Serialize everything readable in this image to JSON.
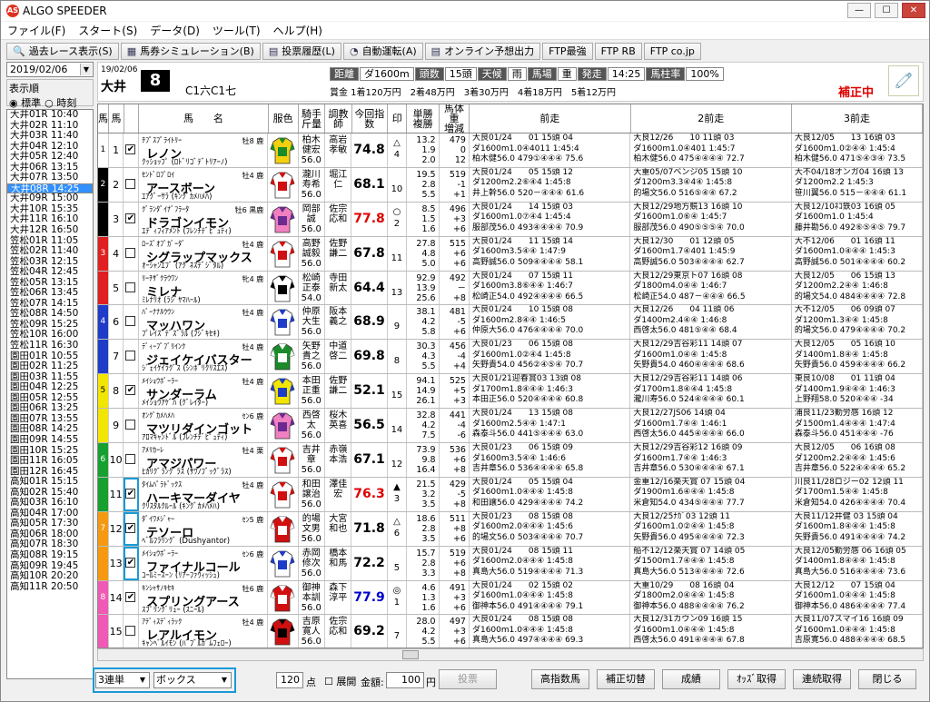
{
  "window": {
    "title": "ALGO SPEEDER",
    "app_icon": "AS"
  },
  "menu": [
    "ファイル(F)",
    "スタート(S)",
    "データ(D)",
    "ツール(T)",
    "ヘルプ(H)"
  ],
  "toolbar": [
    {
      "label": "過去レース表示(S)",
      "icon": "🔍"
    },
    {
      "label": "馬券シミュレーション(B)",
      "icon": "▦"
    },
    {
      "label": "投票履歴(L)",
      "icon": "▤"
    },
    {
      "label": "自動運転(A)",
      "icon": "◔"
    },
    {
      "label": "オンライン予想出力",
      "icon": "▤"
    },
    {
      "label": "FTP最強",
      "icon": ""
    },
    {
      "label": "FTP RB",
      "icon": ""
    },
    {
      "label": "FTP co.jp",
      "icon": ""
    }
  ],
  "left": {
    "date": "2019/02/06",
    "order_label": "表示順",
    "order_options": [
      "標準",
      "時刻"
    ],
    "races": [
      "大井01R 10:40",
      "大井02R 11:10",
      "大井03R 11:40",
      "大井04R 12:10",
      "大井05R 12:40",
      "大井06R 13:15",
      "大井07R 13:50",
      "大井08R 14:25",
      "大井09R 15:00",
      "大井10R 15:35",
      "大井11R 16:10",
      "大井12R 16:50",
      "笠松01R 11:05",
      "笠松02R 11:40",
      "笠松03R 12:15",
      "笠松04R 12:45",
      "笠松05R 13:15",
      "笠松06R 13:45",
      "笠松07R 14:15",
      "笠松08R 14:50",
      "笠松09R 15:25",
      "笠松10R 16:00",
      "笠松11R 16:30",
      "園田01R 10:55",
      "園田02R 11:25",
      "園田03R 11:55",
      "園田04R 12:25",
      "園田05R 12:55",
      "園田06R 13:25",
      "園田07R 13:55",
      "園田08R 14:25",
      "園田09R 14:55",
      "園田10R 15:25",
      "園田11R 16:05",
      "園田12R 16:45",
      "高知01R 15:15",
      "高知02R 15:40",
      "高知03R 16:10",
      "高知04R 17:00",
      "高知05R 17:30",
      "高知06R 18:00",
      "高知07R 18:30",
      "高知08R 19:15",
      "高知09R 19:45",
      "高知10R 20:20",
      "高知11R 20:50"
    ],
    "selected_index": 7
  },
  "header": {
    "date": "19/02/06",
    "venue": "大井",
    "race_no": "8",
    "class": "C1六C1七",
    "distance_label": "距離",
    "distance": "ダ1600m",
    "count_label": "頭数",
    "count": "15頭",
    "weather_label": "天候",
    "weather": "雨",
    "track_label": "馬場",
    "track": "重",
    "post_label": "発走",
    "post": "14:25",
    "ratio_label": "馬柱率",
    "ratio": "100%",
    "prizes": [
      "賞金 1着120万円",
      "2着48万円",
      "3着30万円",
      "4着18万円",
      "5着12万円"
    ],
    "correction": "補正中"
  },
  "columns": [
    "馬",
    "馬",
    "馬　　名",
    "服色",
    "騎手\n斤量",
    "調教\n師",
    "今回指数",
    "印",
    "単勝\n複勝",
    "馬体重\n増減",
    "前走",
    "2前走",
    "3前走"
  ],
  "waku_colors": [
    "#ffffff",
    "#000000",
    "#e02020",
    "#1e3cc8",
    "#f2e600",
    "#16a030",
    "#f59a10",
    "#f05ab4"
  ],
  "horses": [
    {
      "waku": 1,
      "no": "1",
      "check": true,
      "hl": false,
      "sire": "ﾁﾌﾟｽﾌﾟﾗｲﾄﾘｰ",
      "sex": "牡8 鹿",
      "name": "レノン",
      "dam": "ｸｯｼｮｯﾌﾟ (ﾛﾄﾞﾘｺﾞﾃﾞﾄﾘｱｰﾉ)",
      "silk": [
        "#f5d010",
        "#1a8a2a"
      ],
      "jockey": "柏木\n健宏\n56.0",
      "trainer": "高岩\n孝敏",
      "index": "74.8",
      "idxc": "",
      "mark": "△\n4",
      "odds": "13.2\n1.9\n2.0",
      "weight": "479\n0\n12",
      "r1": [
        "大良01/24　　01 15頭 04",
        "ダ1600m1.0④4011 1:45:4",
        "柏木健56.0 479①④④④ 75.6"
      ],
      "r2": [
        "大良12/26　　10 11頭 03",
        "ダ1600m1.0④401 1:45:7",
        "柏木健56.0 475④④④④ 72.7"
      ],
      "r3": [
        "大良12/05　　13 16頭 03",
        "ダ1600m1.0②④④ 1:45:4",
        "柏木健56.0 471⑤④③④ 73.5"
      ]
    },
    {
      "waku": 2,
      "no": "2",
      "check": false,
      "hl": false,
      "sire": "ｾﾝﾄﾞﾛﾌﾞﾛｲ",
      "sex": "牡4 鹿",
      "name": "アースボーン",
      "dam": "ｴｱｸﾞｰｻﾗ (ｷﾝｸﾞｶﾒﾊﾒﾊ)",
      "silk": [
        "#ffffff",
        "#d01010"
      ],
      "jockey": "瀧川\n寿希\n56.0",
      "trainer": "堀江\n仁",
      "index": "68.1",
      "idxc": "",
      "mark": "\n10",
      "odds": "19.5\n2.8\n5.5",
      "weight": "519\n-1\n+1",
      "r1": [
        "大良01/24　　05 15頭 12",
        "ダ1200m2.2⑥④4 1:45:8",
        "井上幹56.0 520－④④④ 61.6"
      ],
      "r2": [
        "大重05/07ベンジ05 15頭 10",
        "ダ1200m3.3④4④ 1:45:8",
        "的場文56.0 516⑤④④ 67.2"
      ],
      "r3": [
        "大不04/18オンガ04 16頭 13",
        "ダ1200m2.2 1:45:3",
        "笹川翼56.0 515－④④④ 61.1"
      ]
    },
    {
      "waku": 2,
      "no": "3",
      "check": true,
      "hl": false,
      "sire": "ｸﾞﾗﾝﾀﾞｲﾅﾞﾌﾗｰﾀ",
      "sex": "牡6 黒鹿",
      "name": "ドラゴンイモン",
      "dam": "ｴﾃﾞｨﾌｨｱﾒﾝﾄ (ﾌﾚﾝﾁﾃﾞﾋﾟｭﾃｨ)",
      "silk": [
        "#f080c0",
        "#6a2a90"
      ],
      "jockey": "岡部\n誠\n56.0",
      "trainer": "佐宗\n応和",
      "index": "77.8",
      "idxc": "red",
      "mark": "○\n2",
      "odds": "8.5\n1.5\n1.6",
      "weight": "496\n+3\n+6",
      "r1": [
        "大良01/24　　14 15頭 03",
        "ダ1600m1.0⑦④4 1:45:4",
        "服部茂56.0 493④④④④ 70.9"
      ],
      "r2": [
        "大良12/29地方競13 16頭 10",
        "ダ1600m1.0⑥④ 1:45:7",
        "服部茂56.0 490⑤⑤⑤④ 70.0"
      ],
      "r3": [
        "大良12/10ﾈｺ鉄03 16頭 05",
        "ダ1600m1.0 1:45:4",
        "藤井勘56.0 492⑥⑤④⑤ 79.7"
      ]
    },
    {
      "waku": 3,
      "no": "4",
      "check": false,
      "hl": false,
      "sire": "ﾛｰｽﾞｵﾌﾞｶﾞｰﾀﾞ",
      "sex": "牡4 鹿",
      "name": "シグラップマックス",
      "dam": "ｵｰｼｬﾝｴﾌﾞ (ｱｸﾞﾈｽﾃﾞｼﾞﾀﾙ)",
      "silk": [
        "#ffffff",
        "#d01010"
      ],
      "jockey": "高野\n誠毅\n56.0",
      "trainer": "佐野\n謙二",
      "index": "67.8",
      "idxc": "",
      "mark": "\n11",
      "odds": "27.8\n4.8\n5.0",
      "weight": "515\n+6\n+6",
      "r1": [
        "大良01/24　　11 15頭 14",
        "ダ1600m3.5④④ 1:47:9",
        "高野誠56.0 509④④④④ 58.1"
      ],
      "r2": [
        "大良12/30　　01 12頭 05",
        "ダ1600m1.7④401 1:45:9",
        "高野誠56.0 503④④④④ 62.7"
      ],
      "r3": [
        "大不12/06　　01 16頭 11",
        "ダ1600m1.0④④④ 1:45:3",
        "高野誠56.0 501④④④④ 60.2"
      ]
    },
    {
      "waku": 3,
      "no": "5",
      "check": false,
      "hl": false,
      "sire": "ﾘｰﾁｻﾞｸﾗｳﾜﾝ",
      "sex": "牝4 鹿",
      "name": "ミレナ",
      "dam": "ﾐﾚﾅﾘｵ (ﾗｼﾞﾔﾏﾊｰﾙ)",
      "silk": [
        "#ffffff",
        "#000000"
      ],
      "jockey": "松崎\n正泰\n54.0",
      "trainer": "寺田\n新太",
      "index": "64.4",
      "idxc": "",
      "mark": "\n13",
      "odds": "92.9\n13.9\n25.6",
      "weight": "492\n－\n+8",
      "r1": [
        "大良01/24　　07 15頭 11",
        "ダ1600m3.8⑥④④ 1:46:7",
        "松崎正54.0 492④④④④ 66.5"
      ],
      "r2": [
        "大良12/29東京ト07 16頭 08",
        "ダ1800m4.0④④ 1:46:7",
        "松崎正54.0 487－④④④ 66.5"
      ],
      "r3": [
        "大良12/05　　06 15頭 13",
        "ダ1200m2.2④④ 1:46:8",
        "的場文54.0 484④④④④ 72.8"
      ]
    },
    {
      "waku": 4,
      "no": "6",
      "check": false,
      "hl": false,
      "sire": "ﾊﾞｰﾅﾅﾙｳｳﾝ",
      "sex": "牡4 鹿",
      "name": "マッハワン",
      "dam": "ﾌﾟﾚｲｽﾞﾃﾞｽﾞﾗﾙ (ﾌｼﾞｷｾｷ)",
      "silk": [
        "#ffffff",
        "#1e3cc8"
      ],
      "jockey": "仲原\n大生\n56.0",
      "trainer": "阪本\n義之",
      "index": "68.9",
      "idxc": "",
      "mark": "\n9",
      "odds": "38.1\n4.2\n5.8",
      "weight": "481\n-5\n+6",
      "r1": [
        "大良01/24　　10 15頭 08",
        "ダ1600m2.8④④ 1:46:5",
        "仲原大56.0 476④④④④ 70.0"
      ],
      "r2": [
        "大良12/26　　04 11頭 06",
        "ダ1400m2.4④④ 1:46:8",
        "西啓太56.0 481⑤④④ 68.4"
      ],
      "r3": [
        "大不12/05　　06 09頭 07",
        "ダ1200m1.3④④ 1:45:8",
        "的場文56.0 479④④④④ 70.2"
      ]
    },
    {
      "waku": 4,
      "no": "7",
      "check": false,
      "hl": false,
      "sire": "ﾃﾞｨｰﾌﾟﾌﾞﾘｲﾝｸ",
      "sex": "牡4 鹿",
      "name": "ジェイケイバスター",
      "dam": "ｼﾞｪｲｹｲﾗｸﾞｽ (ｼﾝﾎﾞﾘｸﾘｽｴｽ)",
      "silk": [
        "#1a8a2a",
        "#ffffff"
      ],
      "jockey": "矢野\n貴之\n56.0",
      "trainer": "中道\n啓二",
      "index": "69.8",
      "idxc": "",
      "mark": "\n8",
      "odds": "30.3\n4.3\n5.5",
      "weight": "456\n-4\n+4",
      "r1": [
        "大良01/23　　06 15頭 08",
        "ダ1600m1.0②④4 1:45:8",
        "矢野貴54.0 456②④⑤④ 70.7"
      ],
      "r2": [
        "大良12/29吉谷彩11 14頭 07",
        "ダ1600m1.0④④ 1:45:8",
        "矢野貴54.0 460④④④④ 68.6"
      ],
      "r3": [
        "大良12/05　　05 16頭 10",
        "ダ1400m1.8④④ 1:45:8",
        "矢野貴56.0 459④④④④ 66.2"
      ]
    },
    {
      "waku": 5,
      "no": "8",
      "check": true,
      "hl": false,
      "sire": "ﾒｲｼｮｳﾎﾞｰﾗｰ",
      "sex": "牡4 鹿",
      "name": "サンダーラム",
      "dam": "ﾒｲｼｮｳｱｹﾞﾊ (ｸﾞﾚｲﾀｰ)",
      "silk": [
        "#f2e600",
        "#1e3cc8"
      ],
      "jockey": "本田\n正重\n56.0",
      "trainer": "佐野\n謙二",
      "index": "52.1",
      "idxc": "",
      "mark": "\n15",
      "odds": "94.1\n14.9\n26.1",
      "weight": "525\n+5\n+3",
      "r1": [
        "大良01/21迎春賞03 13頭 08",
        "ダ1700m1.8④④④ 1:46:3",
        "本田正56.0 520④④④④ 60.8"
      ],
      "r2": [
        "大良12/29吉谷彩11 14頭 06",
        "ダ1700m1.8④④4 1:45:8",
        "瀧川寿56.0 524④④④④ 60.1"
      ],
      "r3": [
        "東良10/08　　01 11頭 04",
        "ダ1400m1.9④④④ 1:46:3",
        "上野翔58.0 520④④④ -34"
      ]
    },
    {
      "waku": 5,
      "no": "9",
      "check": false,
      "hl": false,
      "sire": "ｵﾝｸﾞｶﾒﾊﾒﾊ",
      "sex": "ｾﾝ6 鹿",
      "name": "マツリダインゴット",
      "dam": "ｱﾛﾏｷｬﾝﾄﾞﾙ (ﾌﾚﾝﾁﾃﾞﾋﾟｭﾃｨ)",
      "silk": [
        "#f080c0",
        "#6a2a90"
      ],
      "jockey": "西啓\n太\n56.0",
      "trainer": "桜木\n英喜",
      "index": "56.5",
      "idxc": "",
      "mark": "\n14",
      "odds": "32.8\n4.2\n7.5",
      "weight": "441\n-4\n-6",
      "r1": [
        "大良01/24　　13 15頭 08",
        "ダ1600m2.5④④ 1:47:1",
        "森泰斗56.0 441⑤④④④ 63.0"
      ],
      "r2": [
        "大良12/27JS06 14頭 04",
        "ダ1600m1.7④④ 1:46:1",
        "西啓太56.0 445④④④④ 66.0"
      ],
      "r3": [
        "浦良11/23勤労感 16頭 12",
        "ダ1500m1.4④④④ 1:47:4",
        "森泰斗56.0 451④④④ -76"
      ]
    },
    {
      "waku": 6,
      "no": "10",
      "check": false,
      "hl": false,
      "sire": "ｱﾒﾘｶｰﾚ",
      "sex": "牡4 栗",
      "name": "アマジパワー",
      "dam": "ﾋｶﾘｸﾞﾗﾝｸﾞﾗｽ (ｻﾜﾉﾌﾞｯｸﾞﾗｽ)",
      "silk": [
        "#ffffff",
        "#d01010"
      ],
      "jockey": "吉井\n章\n56.0",
      "trainer": "赤嶺\n本浩",
      "index": "67.1",
      "idxc": "",
      "mark": "\n12",
      "odds": "73.9\n9.8\n16.4",
      "weight": "536\n+6\n+8",
      "r1": [
        "大良01/23　　06 15頭 09",
        "ダ1600m3.5④④ 1:46:6",
        "吉井章56.0 536④④④④ 65.8"
      ],
      "r2": [
        "大良12/29吉谷彩12 16頭 09",
        "ダ1600m1.7④④ 1:46:3",
        "吉井章56.0 530④④④④ 67.1"
      ],
      "r3": [
        "大良12/05　　06 16頭 08",
        "ダ1200m2.2④④④ 1:45:6",
        "吉井章56.0 522④④④④ 65.2"
      ]
    },
    {
      "waku": 6,
      "no": "11",
      "check": true,
      "hl": true,
      "sire": "ﾀｲﾑﾊﾟﾗﾄﾞｯｸｽ",
      "sex": "牡4 鹿",
      "name": "ハーキマーダイヤ",
      "dam": "ｸﾘｽﾀﾙｸﾙｰﾙ (ｷﾝｸﾞｶﾒﾊﾒﾊ)",
      "silk": [
        "#ffffff",
        "#d01010"
      ],
      "jockey": "和田\n譲治\n56.0",
      "trainer": "澤佳\n宏",
      "index": "76.3",
      "idxc": "red",
      "mark": "▲\n3",
      "odds": "21.5\n3.2\n3.5",
      "weight": "429\n-5\n+8",
      "r1": [
        "大良01/24　　05 15頭 04",
        "ダ1600m1.0④④④ 1:45:8",
        "和田譲56.0 429④④④④ 74.2"
      ],
      "r2": [
        "金重12/16楽天賞 07 15頭 04",
        "ダ1900m1.6④④④ 1:45:8",
        "米倉知54.0 434⑤④④④ 77.7"
      ],
      "r3": [
        "川良11/28ロジー02 12頭 11",
        "ダ1700m1.5④④ 1:45:8",
        "米倉知54.0 426④④④④ 70.4"
      ]
    },
    {
      "waku": 7,
      "no": "12",
      "check": true,
      "hl": true,
      "sire": "ﾀﾞｲﾜﾒｼﾞｬｰ",
      "sex": "ｾﾝ5 鹿",
      "name": "テソーロ",
      "dam": "ﾍﾞﾙﾌﾗﾘﾝｸﾞ (Dushyantor)",
      "silk": [
        "#d01010",
        "#ffffff"
      ],
      "jockey": "的場\n文男\n56.0",
      "trainer": "大宮\n和也",
      "index": "71.8",
      "idxc": "",
      "mark": "△\n6",
      "odds": "18.6\n2.8\n3.5",
      "weight": "511\n+8\n+6",
      "r1": [
        "大良01/23　　08 15頭 08",
        "ダ1600m2.0④④④ 1:45:6",
        "的場文56.0 503④④④④ 70.7"
      ],
      "r2": [
        "大良12/25ﾅｶﾞ03 12頭 11",
        "ダ1600m1.0②④④ 1:45:8",
        "矢野貴56.0 495④④④④ 72.3"
      ],
      "r3": [
        "大良11/12井健 03 15頭 04",
        "ダ1600m1.8④④④ 1:45:8",
        "矢野貴56.0 491④④④④ 74.2"
      ]
    },
    {
      "waku": 7,
      "no": "13",
      "check": true,
      "hl": true,
      "sire": "ﾒｲｼｮｳﾎﾞｰﾗｰ",
      "sex": "ｾﾝ6 鹿",
      "name": "ファイナルコール",
      "dam": "ｺｰﾙﾐｰｽｰﾝ (ﾘｱｰﾌｧｳｨｯｼｭ)",
      "silk": [
        "#ffffff",
        "#1e3cc8"
      ],
      "jockey": "赤岡\n修次\n56.0",
      "trainer": "橋本\n和馬",
      "index": "72.2",
      "idxc": "",
      "mark": "\n5",
      "odds": "15.7\n2.8\n3.3",
      "weight": "519\n+6\n+8",
      "r1": [
        "大良01/24　　08 15頭 11",
        "ダ1600m2.0④④④ 1:45:8",
        "真島大56.0 519④④④④ 71.3"
      ],
      "r2": [
        "船不12/12楽天賞 07 14頭 05",
        "ダ1500m1.7④④④ 1:45:8",
        "真島大56.0 513④④④④ 72.6"
      ],
      "r3": [
        "大良12/05勤労感 06 16頭 05",
        "ダ1400m1.8④④④ 1:45:8",
        "真島大56.0 516④④④④ 73.6"
      ]
    },
    {
      "waku": 8,
      "no": "14",
      "check": true,
      "hl": false,
      "sire": "ｷﾝｼｬｻﾉｷｾｷ",
      "sex": "牡6 鹿",
      "name": "スプリングアース",
      "dam": "ｽﾌﾟﾘﾝｸﾞﾘｭｰ (ｽﾆｰﾙ)",
      "silk": [
        "#d01010",
        "#ffffff"
      ],
      "jockey": "御神\n本訓\n56.0",
      "trainer": "森下\n淳平",
      "index": "77.9",
      "idxc": "blue",
      "mark": "◎\n1",
      "odds": "4.6\n1.3\n1.6",
      "weight": "491\n+3\n+6",
      "r1": [
        "大良01/24　　02 15頭 02",
        "ダ1600m1.0④④④ 1:45:8",
        "御神本56.0 491④④④④ 79.1"
      ],
      "r2": [
        "大重10/29　　08 16頭 04",
        "ダ1800m2.0④④④ 1:45:8",
        "御神本56.0 488④④④④ 76.2"
      ],
      "r3": [
        "大良12/12　　07 15頭 04",
        "ダ1600m1.0④④④ 1:45:8",
        "御神本56.0 486④④④④ 77.4"
      ]
    },
    {
      "waku": 8,
      "no": "15",
      "check": false,
      "hl": false,
      "sire": "ｱﾃﾞｨｽﾃﾞｨﾗｯｸ",
      "sex": "牡4 鹿",
      "name": "レアルイモン",
      "dam": "ｷｬﾝﾍﾞﾙｲﾓﾝ (ﾊﾞﾌﾞﾙｶﾞﾑﾌｪﾛｰ)",
      "silk": [
        "#d01010",
        "#000000"
      ],
      "jockey": "吉原\n寛人\n56.0",
      "trainer": "佐宗\n応和",
      "index": "69.2",
      "idxc": "",
      "mark": "\n7",
      "odds": "28.0\n4.2\n5.5",
      "weight": "497\n+3\n+6",
      "r1": [
        "大良01/24　　08 15頭 08",
        "ダ1600m1.0④④④ 1:45:8",
        "真島大56.0 497④④④④ 69.3"
      ],
      "r2": [
        "大良12/31カウン09 16頭 15",
        "ダ1600m1.0④④④ 1:45:8",
        "西啓太56.0 491④④④④ 67.8"
      ],
      "r3": [
        "大良11/07スマイ16 16頭 09",
        "ダ1600m1.0④④④ 1:45:8",
        "吉原寛56.0 488④④④④ 68.5"
      ]
    }
  ],
  "bottom": {
    "bet_type": "3連単",
    "bet_method": "ボックス",
    "points": "120",
    "points_unit": "点",
    "expand": "展開",
    "amount_label": "金額:",
    "amount": "100",
    "amount_unit": "円",
    "buttons": [
      "投票",
      "高指数馬",
      "補正切替",
      "成績",
      "ｵｯｽﾞ取得",
      "連続取得",
      "閉じる"
    ]
  }
}
